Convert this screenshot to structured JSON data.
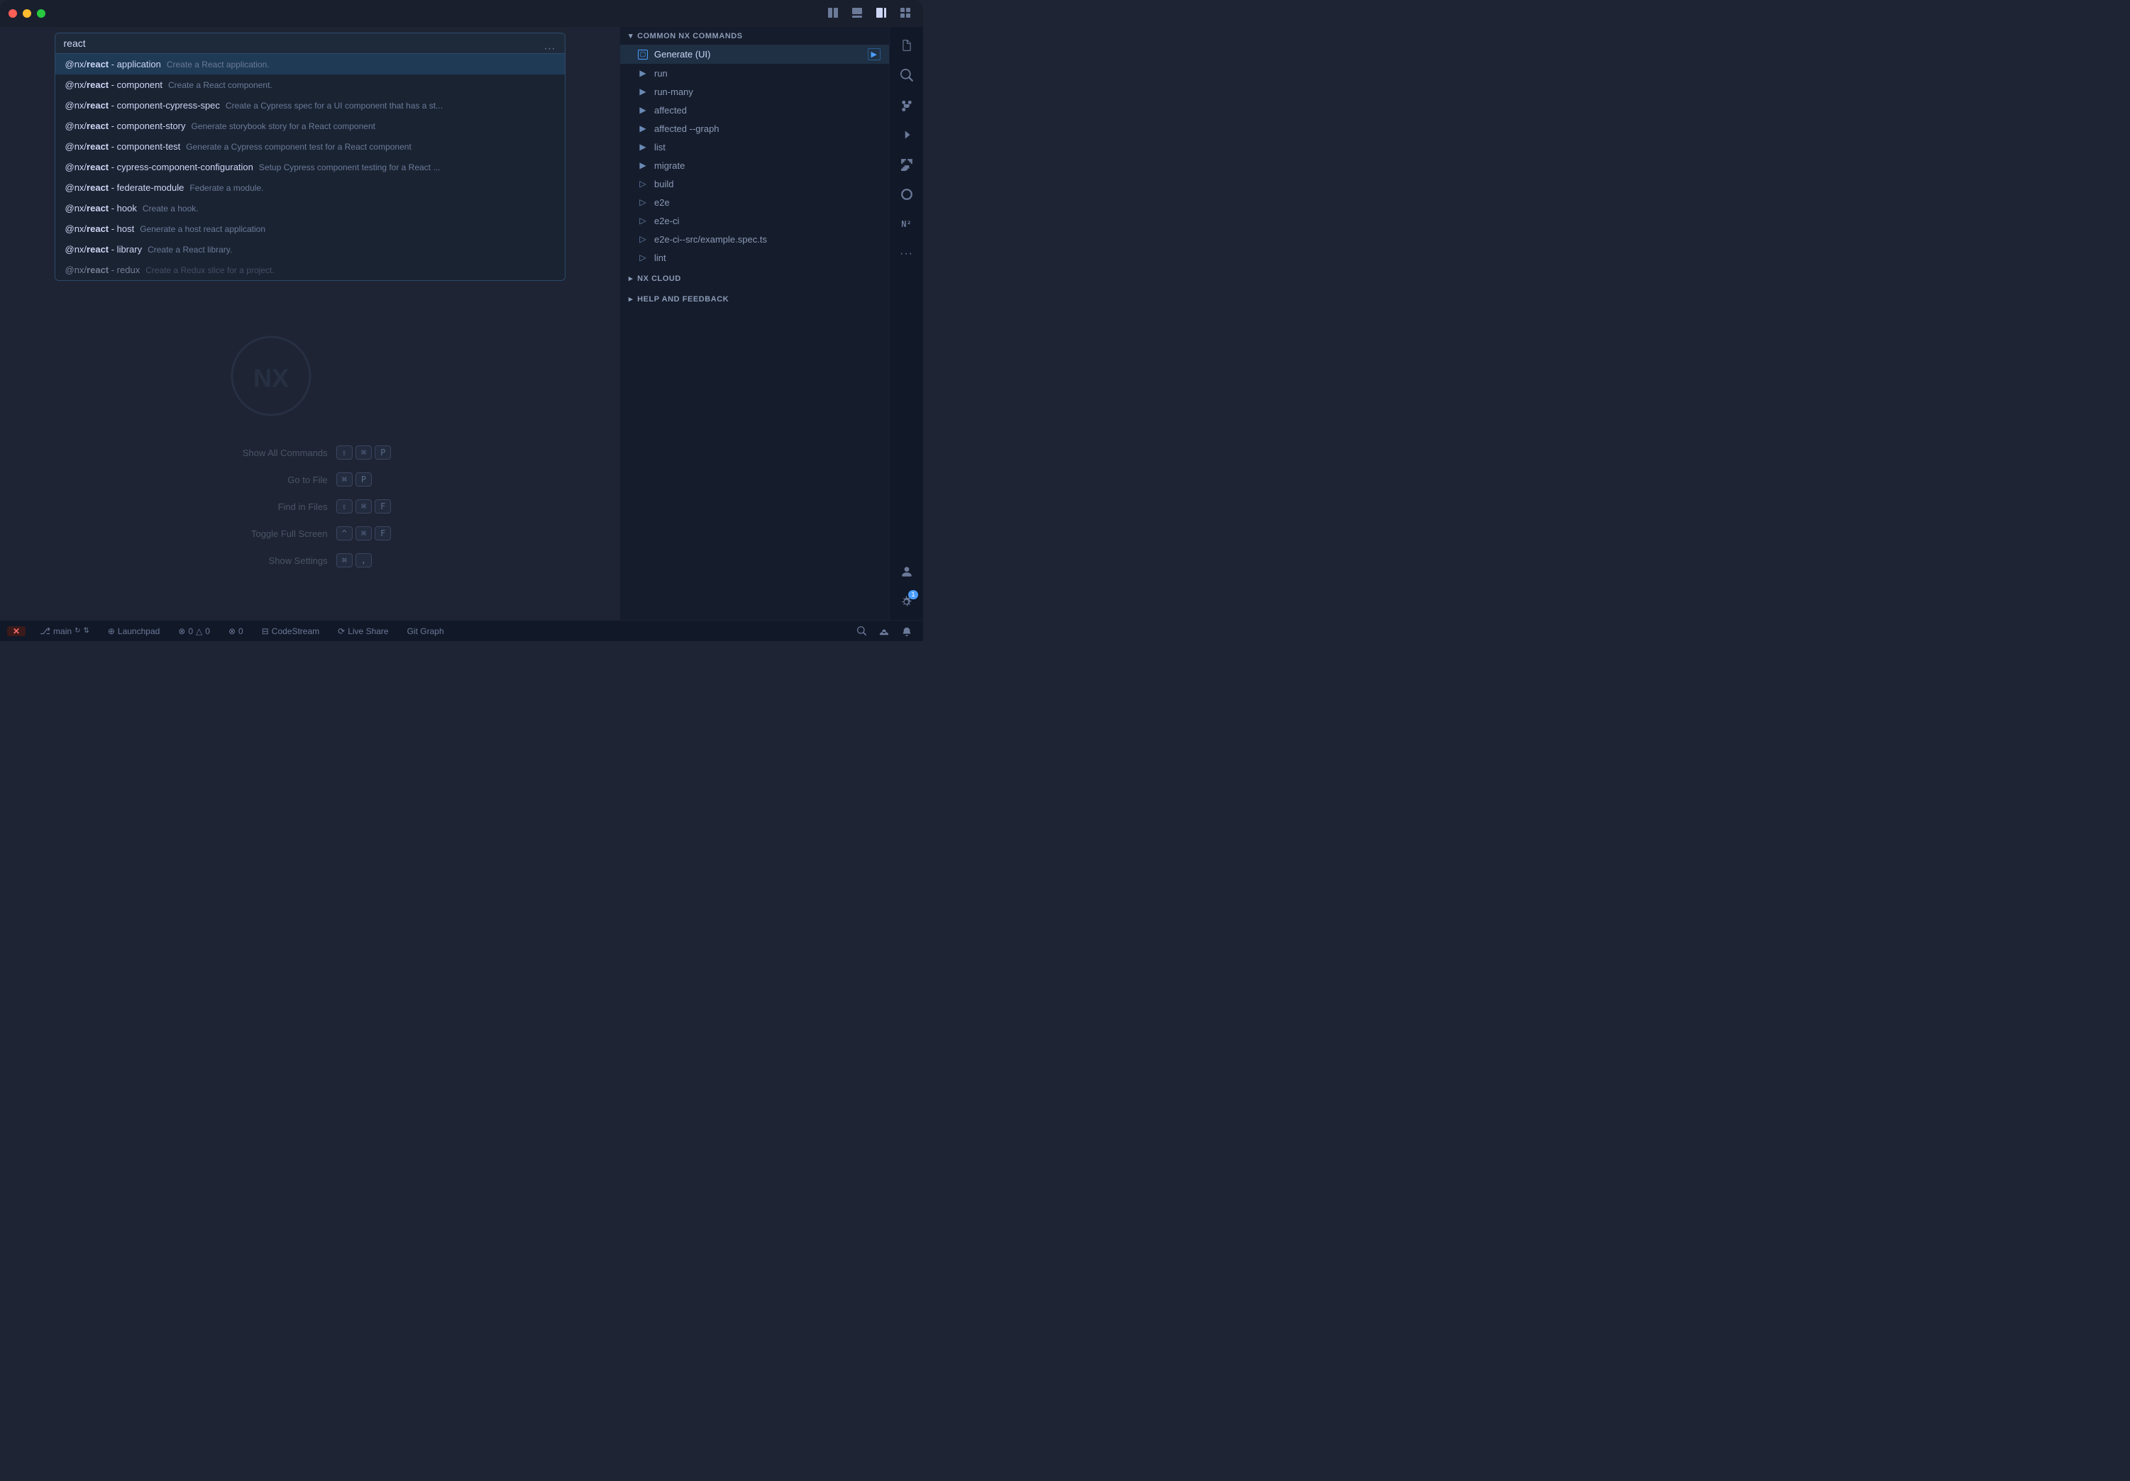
{
  "titleBar": {
    "icons": [
      "editor-layout-icon",
      "panel-layout-icon",
      "sidebar-right-icon",
      "grid-layout-icon"
    ]
  },
  "commandPalette": {
    "searchValue": "react",
    "moreLabel": "···",
    "items": [
      {
        "prefix": "@nx/",
        "boldPart": "react",
        "rest": " - application",
        "desc": "Create a React application.",
        "active": true
      },
      {
        "prefix": "@nx/",
        "boldPart": "react",
        "rest": " - component",
        "desc": "Create a React component.",
        "active": false
      },
      {
        "prefix": "@nx/",
        "boldPart": "react",
        "rest": " - component-cypress-spec",
        "desc": "Create a Cypress spec for a UI component that has a st...",
        "active": false
      },
      {
        "prefix": "@nx/",
        "boldPart": "react",
        "rest": " - component-story",
        "desc": "Generate storybook story for a React component",
        "active": false
      },
      {
        "prefix": "@nx/",
        "boldPart": "react",
        "rest": " - component-test",
        "desc": "Generate a Cypress component test for a React component",
        "active": false
      },
      {
        "prefix": "@nx/",
        "boldPart": "react",
        "rest": " - cypress-component-configuration",
        "desc": "Setup Cypress component testing for a React ...",
        "active": false
      },
      {
        "prefix": "@nx/",
        "boldPart": "react",
        "rest": " - federate-module",
        "desc": "Federate a module.",
        "active": false
      },
      {
        "prefix": "@nx/",
        "boldPart": "react",
        "rest": " - hook",
        "desc": "Create a hook.",
        "active": false
      },
      {
        "prefix": "@nx/",
        "boldPart": "react",
        "rest": " - host",
        "desc": "Generate a host react application",
        "active": false
      },
      {
        "prefix": "@nx/",
        "boldPart": "react",
        "rest": " - library",
        "desc": "Create a React library.",
        "active": false
      },
      {
        "prefix": "@nx/",
        "boldPart": "react",
        "rest": " - redux",
        "desc": "Create a Redux slice for a project.",
        "active": false
      }
    ]
  },
  "shortcuts": [
    {
      "label": "Show All Commands",
      "keys": [
        "⇧",
        "⌘",
        "P"
      ]
    },
    {
      "label": "Go to File",
      "keys": [
        "⌘",
        "P"
      ]
    },
    {
      "label": "Find in Files",
      "keys": [
        "⇧",
        "⌘",
        "F"
      ]
    },
    {
      "label": "Toggle Full Screen",
      "keys": [
        "^",
        "⌘",
        "F"
      ]
    },
    {
      "label": "Show Settings",
      "keys": [
        "⌘",
        ","
      ]
    }
  ],
  "nxPanel": {
    "sections": [
      {
        "title": "COMMON NX COMMANDS",
        "collapsed": false,
        "items": [
          {
            "label": "Generate (UI)",
            "icon": "terminal",
            "active": true,
            "hasRunIcon": true
          },
          {
            "label": "run",
            "icon": "run-filled",
            "active": false
          },
          {
            "label": "run-many",
            "icon": "run-filled",
            "active": false
          },
          {
            "label": "affected",
            "icon": "run-filled",
            "active": false
          },
          {
            "label": "affected --graph",
            "icon": "run-filled",
            "active": false
          },
          {
            "label": "list",
            "icon": "run-filled",
            "active": false
          },
          {
            "label": "migrate",
            "icon": "run-filled",
            "active": false
          },
          {
            "label": "build",
            "icon": "run-outline",
            "active": false
          },
          {
            "label": "e2e",
            "icon": "run-outline",
            "active": false
          },
          {
            "label": "e2e-ci",
            "icon": "run-outline",
            "active": false
          },
          {
            "label": "e2e-ci--src/example.spec.ts",
            "icon": "run-outline",
            "active": false
          },
          {
            "label": "lint",
            "icon": "run-outline",
            "active": false
          }
        ]
      },
      {
        "title": "NX CLOUD",
        "collapsed": true,
        "items": []
      },
      {
        "title": "HELP AND FEEDBACK",
        "collapsed": true,
        "items": []
      }
    ]
  },
  "activityBar": {
    "icons": [
      {
        "name": "files-icon",
        "symbol": "📄",
        "active": false
      },
      {
        "name": "search-icon",
        "symbol": "🔍",
        "active": false
      },
      {
        "name": "source-control-icon",
        "symbol": "⎇",
        "active": false
      },
      {
        "name": "run-debug-icon",
        "symbol": "▷",
        "active": false
      },
      {
        "name": "extensions-icon",
        "symbol": "⊞",
        "active": false
      },
      {
        "name": "remote-icon",
        "symbol": "⬡",
        "active": false
      },
      {
        "name": "nx-icon",
        "symbol": "N²",
        "active": false
      },
      {
        "name": "more-icon",
        "symbol": "···",
        "active": false
      }
    ],
    "bottomIcons": [
      {
        "name": "account-icon",
        "symbol": "👤",
        "active": false
      },
      {
        "name": "settings-icon",
        "symbol": "⚙",
        "badge": "1",
        "active": false
      }
    ]
  },
  "statusBar": {
    "leftItems": [
      {
        "label": "main",
        "icon": "⎇",
        "clickable": true
      },
      {
        "icon": "↻",
        "clickable": true
      },
      {
        "icon": "⇅",
        "clickable": true
      },
      {
        "label": "Launchpad",
        "icon": "⊕",
        "clickable": true
      },
      {
        "label": "0",
        "icon": "⊗",
        "clickable": true
      },
      {
        "label": "0",
        "icon": "△",
        "clickable": true
      },
      {
        "label": "0",
        "icon": "⊗",
        "clickable": true
      },
      {
        "label": "CodeStream",
        "icon": "⊟",
        "clickable": true
      },
      {
        "label": "Live Share",
        "icon": "⟳",
        "clickable": true
      },
      {
        "label": "Git Graph",
        "clickable": true
      }
    ],
    "rightItems": [
      {
        "icon": "🔍",
        "clickable": true
      },
      {
        "icon": "👥",
        "clickable": true
      },
      {
        "icon": "🔔",
        "clickable": true
      }
    ]
  }
}
